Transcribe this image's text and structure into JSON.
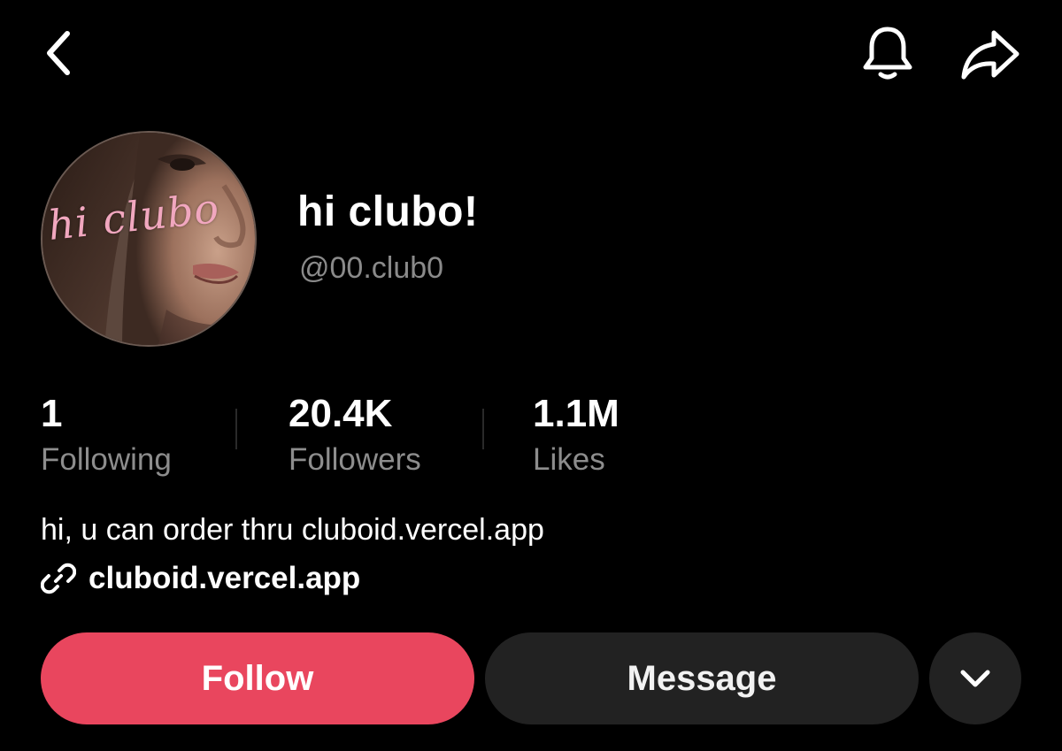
{
  "nav": {
    "back_icon": "chevron-left-icon",
    "bell_icon": "bell-icon",
    "share_icon": "share-arrow-icon"
  },
  "profile": {
    "avatar_text": "hi clubo",
    "display_name": "hi clubo!",
    "handle": "@00.club0"
  },
  "stats": [
    {
      "value": "1",
      "label": "Following"
    },
    {
      "value": "20.4K",
      "label": "Followers"
    },
    {
      "value": "1.1M",
      "label": "Likes"
    }
  ],
  "bio": {
    "text": "hi, u can order thru cluboid.vercel.app",
    "link_icon": "link-icon",
    "link": "cluboid.vercel.app"
  },
  "actions": {
    "follow_label": "Follow",
    "message_label": "Message",
    "more_icon": "chevron-down-icon"
  },
  "colors": {
    "background": "#000000",
    "follow": "#e9465e",
    "secondary_button": "#222222",
    "muted_text": "#8d8d8d"
  }
}
